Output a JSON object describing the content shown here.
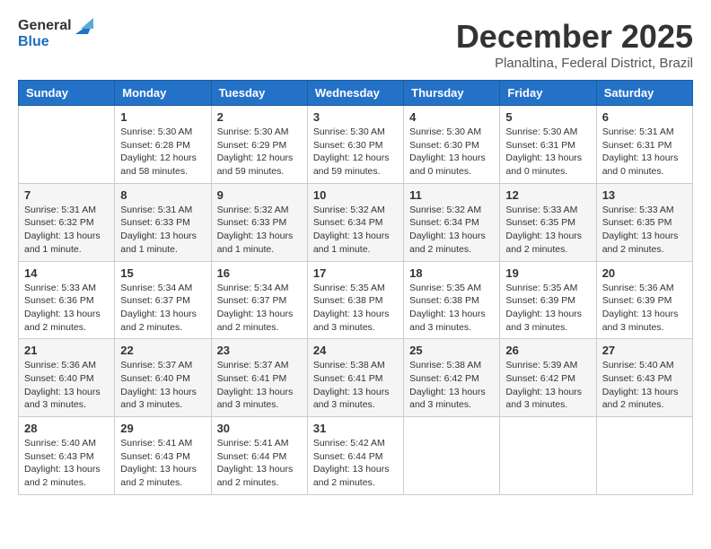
{
  "header": {
    "logo_general": "General",
    "logo_blue": "Blue",
    "month_title": "December 2025",
    "location": "Planaltina, Federal District, Brazil"
  },
  "days_of_week": [
    "Sunday",
    "Monday",
    "Tuesday",
    "Wednesday",
    "Thursday",
    "Friday",
    "Saturday"
  ],
  "weeks": [
    [
      {
        "day": "",
        "info": ""
      },
      {
        "day": "1",
        "info": "Sunrise: 5:30 AM\nSunset: 6:28 PM\nDaylight: 12 hours\nand 58 minutes."
      },
      {
        "day": "2",
        "info": "Sunrise: 5:30 AM\nSunset: 6:29 PM\nDaylight: 12 hours\nand 59 minutes."
      },
      {
        "day": "3",
        "info": "Sunrise: 5:30 AM\nSunset: 6:30 PM\nDaylight: 12 hours\nand 59 minutes."
      },
      {
        "day": "4",
        "info": "Sunrise: 5:30 AM\nSunset: 6:30 PM\nDaylight: 13 hours\nand 0 minutes."
      },
      {
        "day": "5",
        "info": "Sunrise: 5:30 AM\nSunset: 6:31 PM\nDaylight: 13 hours\nand 0 minutes."
      },
      {
        "day": "6",
        "info": "Sunrise: 5:31 AM\nSunset: 6:31 PM\nDaylight: 13 hours\nand 0 minutes."
      }
    ],
    [
      {
        "day": "7",
        "info": "Sunrise: 5:31 AM\nSunset: 6:32 PM\nDaylight: 13 hours\nand 1 minute."
      },
      {
        "day": "8",
        "info": "Sunrise: 5:31 AM\nSunset: 6:33 PM\nDaylight: 13 hours\nand 1 minute."
      },
      {
        "day": "9",
        "info": "Sunrise: 5:32 AM\nSunset: 6:33 PM\nDaylight: 13 hours\nand 1 minute."
      },
      {
        "day": "10",
        "info": "Sunrise: 5:32 AM\nSunset: 6:34 PM\nDaylight: 13 hours\nand 1 minute."
      },
      {
        "day": "11",
        "info": "Sunrise: 5:32 AM\nSunset: 6:34 PM\nDaylight: 13 hours\nand 2 minutes."
      },
      {
        "day": "12",
        "info": "Sunrise: 5:33 AM\nSunset: 6:35 PM\nDaylight: 13 hours\nand 2 minutes."
      },
      {
        "day": "13",
        "info": "Sunrise: 5:33 AM\nSunset: 6:35 PM\nDaylight: 13 hours\nand 2 minutes."
      }
    ],
    [
      {
        "day": "14",
        "info": "Sunrise: 5:33 AM\nSunset: 6:36 PM\nDaylight: 13 hours\nand 2 minutes."
      },
      {
        "day": "15",
        "info": "Sunrise: 5:34 AM\nSunset: 6:37 PM\nDaylight: 13 hours\nand 2 minutes."
      },
      {
        "day": "16",
        "info": "Sunrise: 5:34 AM\nSunset: 6:37 PM\nDaylight: 13 hours\nand 2 minutes."
      },
      {
        "day": "17",
        "info": "Sunrise: 5:35 AM\nSunset: 6:38 PM\nDaylight: 13 hours\nand 3 minutes."
      },
      {
        "day": "18",
        "info": "Sunrise: 5:35 AM\nSunset: 6:38 PM\nDaylight: 13 hours\nand 3 minutes."
      },
      {
        "day": "19",
        "info": "Sunrise: 5:35 AM\nSunset: 6:39 PM\nDaylight: 13 hours\nand 3 minutes."
      },
      {
        "day": "20",
        "info": "Sunrise: 5:36 AM\nSunset: 6:39 PM\nDaylight: 13 hours\nand 3 minutes."
      }
    ],
    [
      {
        "day": "21",
        "info": "Sunrise: 5:36 AM\nSunset: 6:40 PM\nDaylight: 13 hours\nand 3 minutes."
      },
      {
        "day": "22",
        "info": "Sunrise: 5:37 AM\nSunset: 6:40 PM\nDaylight: 13 hours\nand 3 minutes."
      },
      {
        "day": "23",
        "info": "Sunrise: 5:37 AM\nSunset: 6:41 PM\nDaylight: 13 hours\nand 3 minutes."
      },
      {
        "day": "24",
        "info": "Sunrise: 5:38 AM\nSunset: 6:41 PM\nDaylight: 13 hours\nand 3 minutes."
      },
      {
        "day": "25",
        "info": "Sunrise: 5:38 AM\nSunset: 6:42 PM\nDaylight: 13 hours\nand 3 minutes."
      },
      {
        "day": "26",
        "info": "Sunrise: 5:39 AM\nSunset: 6:42 PM\nDaylight: 13 hours\nand 3 minutes."
      },
      {
        "day": "27",
        "info": "Sunrise: 5:40 AM\nSunset: 6:43 PM\nDaylight: 13 hours\nand 2 minutes."
      }
    ],
    [
      {
        "day": "28",
        "info": "Sunrise: 5:40 AM\nSunset: 6:43 PM\nDaylight: 13 hours\nand 2 minutes."
      },
      {
        "day": "29",
        "info": "Sunrise: 5:41 AM\nSunset: 6:43 PM\nDaylight: 13 hours\nand 2 minutes."
      },
      {
        "day": "30",
        "info": "Sunrise: 5:41 AM\nSunset: 6:44 PM\nDaylight: 13 hours\nand 2 minutes."
      },
      {
        "day": "31",
        "info": "Sunrise: 5:42 AM\nSunset: 6:44 PM\nDaylight: 13 hours\nand 2 minutes."
      },
      {
        "day": "",
        "info": ""
      },
      {
        "day": "",
        "info": ""
      },
      {
        "day": "",
        "info": ""
      }
    ]
  ]
}
